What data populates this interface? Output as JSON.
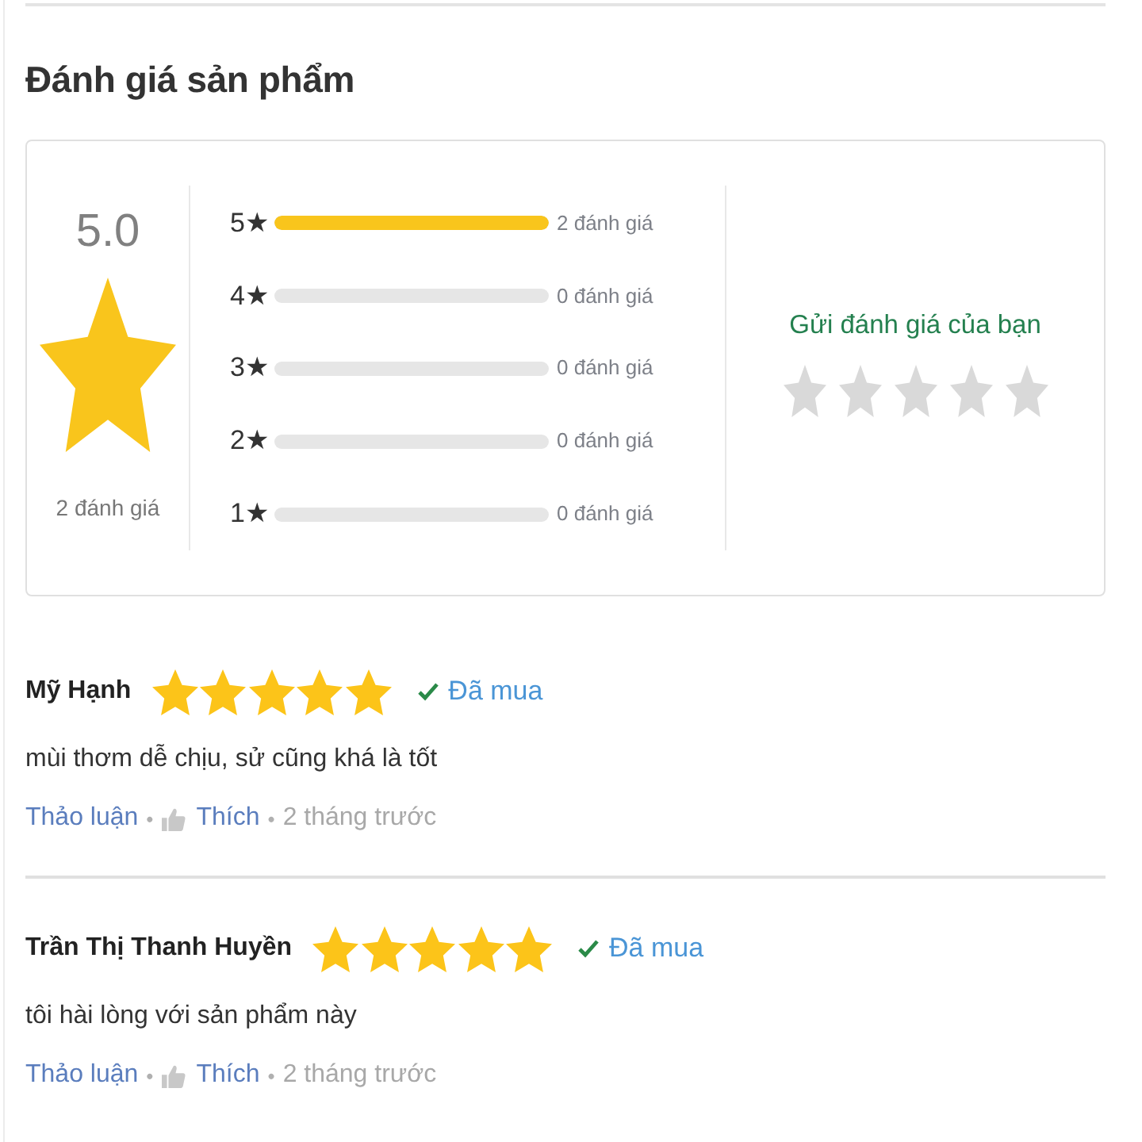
{
  "section": {
    "title": "Đánh giá sản phẩm"
  },
  "summary": {
    "average": "5.0",
    "total": "2 đánh giá"
  },
  "breakdown": [
    {
      "label": "5★",
      "level": 1,
      "count": "2 đánh giá"
    },
    {
      "label": "4★",
      "level": 0,
      "count": "0 đánh giá"
    },
    {
      "label": "3★",
      "level": 0,
      "count": "0 đánh giá"
    },
    {
      "label": "2★",
      "level": 0,
      "count": "0 đánh giá"
    },
    {
      "label": "1★",
      "level": 0,
      "count": "0 đánh giá"
    }
  ],
  "write_review": {
    "label": "Gửi đánh giá của bạn",
    "stars": 0
  },
  "reviews": [
    {
      "name": "Mỹ Hạnh",
      "stars": 5,
      "verified": true,
      "verified_label": "Đã mua",
      "text": "mùi thơm dễ chịu, sử cũng khá là tốt",
      "footer": [
        {
          "kind": "link",
          "text": "Thảo luận"
        },
        {
          "kind": "separator",
          "text": "•"
        },
        {
          "kind": "like",
          "text": "Thích"
        },
        {
          "kind": "separator",
          "text": "•"
        },
        {
          "kind": "time",
          "text": "2 tháng trước"
        }
      ]
    },
    {
      "name": "Trần Thị Thanh Huyền",
      "stars": 5,
      "verified": true,
      "verified_label": "Đã mua",
      "text": "tôi hài lòng với sản phẩm này",
      "footer": [
        {
          "kind": "link",
          "text": "Thảo luận"
        },
        {
          "kind": "separator",
          "text": "•"
        },
        {
          "kind": "like",
          "text": "Thích"
        },
        {
          "kind": "separator",
          "text": "•"
        },
        {
          "kind": "time",
          "text": "2 tháng trước"
        }
      ]
    }
  ]
}
